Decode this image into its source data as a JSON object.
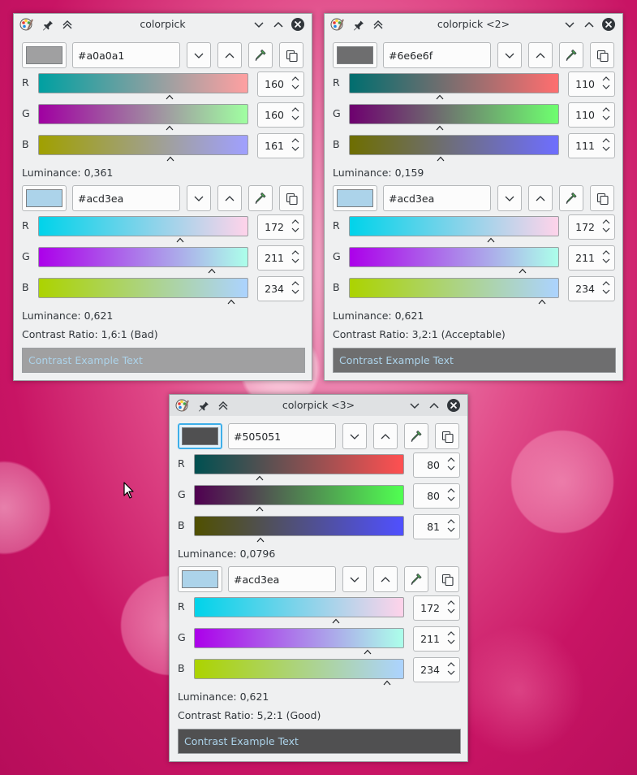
{
  "windows": [
    {
      "title": "colorpick",
      "active": false,
      "fg": {
        "hex": "#a0a0a1",
        "swatch": "#a0a0a1",
        "channels": [
          {
            "label": "R",
            "value": "160",
            "level": 0.627,
            "grad": [
              "#00a0a1",
              "#ffa0a1"
            ]
          },
          {
            "label": "G",
            "value": "160",
            "level": 0.627,
            "grad": [
              "#a000a1",
              "#a0ffa1"
            ]
          },
          {
            "label": "B",
            "value": "161",
            "level": 0.631,
            "grad": [
              "#a0a000",
              "#a0a0ff"
            ]
          }
        ],
        "luminance": "Luminance: 0,361"
      },
      "bg": {
        "hex": "#acd3ea",
        "swatch": "#acd3ea",
        "channels": [
          {
            "label": "R",
            "value": "172",
            "level": 0.675,
            "grad": [
              "#00d3ea",
              "#ffd3ea"
            ]
          },
          {
            "label": "G",
            "value": "211",
            "level": 0.827,
            "grad": [
              "#ac00ea",
              "#acffea"
            ]
          },
          {
            "label": "B",
            "value": "234",
            "level": 0.918,
            "grad": [
              "#acd300",
              "#acd3ff"
            ]
          }
        ],
        "luminance": "Luminance: 0,621"
      },
      "contrast": "Contrast Ratio: 1,6:1 (Bad)",
      "sample_text": "Contrast Example Text",
      "sample_bg": "#a0a0a1",
      "sample_fg": "#acd3ea"
    },
    {
      "title": "colorpick <2>",
      "active": false,
      "fg": {
        "hex": "#6e6e6f",
        "swatch": "#6e6e6f",
        "channels": [
          {
            "label": "R",
            "value": "110",
            "level": 0.431,
            "grad": [
              "#006e6f",
              "#ff6e6f"
            ]
          },
          {
            "label": "G",
            "value": "110",
            "level": 0.431,
            "grad": [
              "#6e006f",
              "#6eff6f"
            ]
          },
          {
            "label": "B",
            "value": "111",
            "level": 0.435,
            "grad": [
              "#6e6e00",
              "#6e6eff"
            ]
          }
        ],
        "luminance": "Luminance: 0,159"
      },
      "bg": {
        "hex": "#acd3ea",
        "swatch": "#acd3ea",
        "channels": [
          {
            "label": "R",
            "value": "172",
            "level": 0.675,
            "grad": [
              "#00d3ea",
              "#ffd3ea"
            ]
          },
          {
            "label": "G",
            "value": "211",
            "level": 0.827,
            "grad": [
              "#ac00ea",
              "#acffea"
            ]
          },
          {
            "label": "B",
            "value": "234",
            "level": 0.918,
            "grad": [
              "#acd300",
              "#acd3ff"
            ]
          }
        ],
        "luminance": "Luminance: 0,621"
      },
      "contrast": "Contrast Ratio: 3,2:1 (Acceptable)",
      "sample_text": "Contrast Example Text",
      "sample_bg": "#6e6e6f",
      "sample_fg": "#acd3ea"
    },
    {
      "title": "colorpick <3>",
      "active": true,
      "fg": {
        "hex": "#505051",
        "swatch": "#505051",
        "channels": [
          {
            "label": "R",
            "value": "80",
            "level": 0.314,
            "grad": [
              "#005051",
              "#ff5051"
            ]
          },
          {
            "label": "G",
            "value": "80",
            "level": 0.314,
            "grad": [
              "#500051",
              "#50ff51"
            ]
          },
          {
            "label": "B",
            "value": "81",
            "level": 0.318,
            "grad": [
              "#505000",
              "#5050ff"
            ]
          }
        ],
        "luminance": "Luminance: 0,0796"
      },
      "bg": {
        "hex": "#acd3ea",
        "swatch": "#acd3ea",
        "channels": [
          {
            "label": "R",
            "value": "172",
            "level": 0.675,
            "grad": [
              "#00d3ea",
              "#ffd3ea"
            ]
          },
          {
            "label": "G",
            "value": "211",
            "level": 0.827,
            "grad": [
              "#ac00ea",
              "#acffea"
            ]
          },
          {
            "label": "B",
            "value": "234",
            "level": 0.918,
            "grad": [
              "#acd300",
              "#acd3ff"
            ]
          }
        ],
        "luminance": "Luminance: 0,621"
      },
      "contrast": "Contrast Ratio: 5,2:1 (Good)",
      "sample_text": "Contrast Example Text",
      "sample_bg": "#505051",
      "sample_fg": "#acd3ea"
    }
  ],
  "icons": {
    "app": "colorpick-app-icon",
    "pin": "pin-icon",
    "keep_above": "keep-above-icon",
    "minimize": "minimize-icon",
    "maximize": "maximize-icon",
    "close": "close-icon",
    "decrease": "darken-icon",
    "increase": "lighten-icon",
    "picker": "eyedropper-icon",
    "copy": "copy-icon",
    "cursor": "mouse-cursor-icon"
  }
}
